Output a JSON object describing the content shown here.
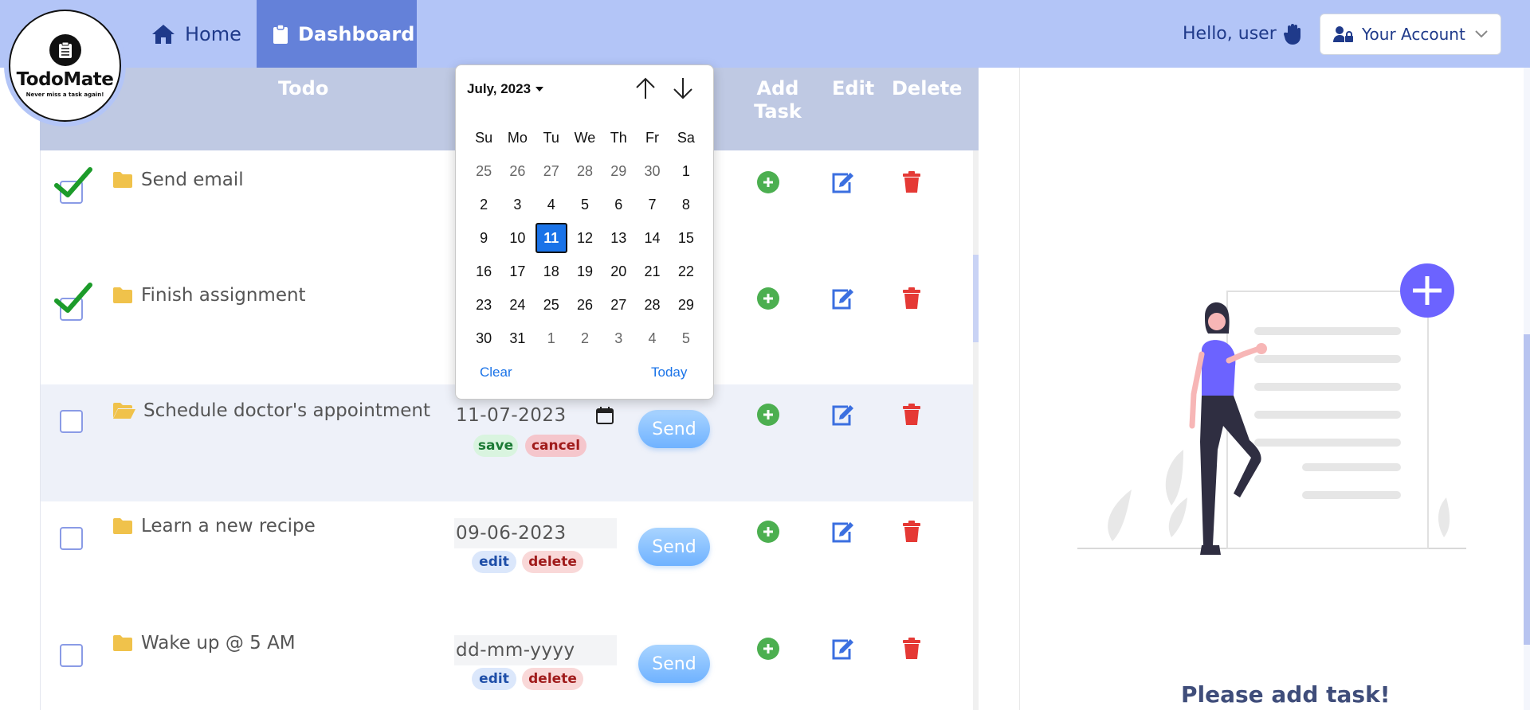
{
  "brand": {
    "name": "TodoMate",
    "tagline": "Never miss a task again!"
  },
  "nav": {
    "home_label": "Home",
    "dashboard_label": "Dashboard",
    "greeting": "Hello, user",
    "account_label": "Your Account"
  },
  "table": {
    "headers": {
      "todo": "Todo",
      "add_task": "Add Task",
      "edit": "Edit",
      "delete": "Delete"
    },
    "rows": [
      {
        "text": "Send email",
        "checked": true,
        "date": "",
        "send": ""
      },
      {
        "text": "Finish assignment",
        "checked": true,
        "date": "",
        "send": ""
      },
      {
        "text": "Schedule doctor's appointment",
        "checked": false,
        "date": "11-07-2023",
        "send": "Send",
        "action1": "save",
        "action2": "cancel"
      },
      {
        "text": "Learn a new recipe",
        "checked": false,
        "date": "09-06-2023",
        "send": "Send",
        "action1": "edit",
        "action2": "delete"
      },
      {
        "text": "Wake up @ 5 AM",
        "checked": false,
        "date": "dd-mm-yyyy",
        "send": "Send",
        "action1": "edit",
        "action2": "delete"
      }
    ]
  },
  "datepicker": {
    "month_label": "July, 2023",
    "weekdays": [
      "Su",
      "Mo",
      "Tu",
      "We",
      "Th",
      "Fr",
      "Sa"
    ],
    "weeks": [
      [
        "25",
        "26",
        "27",
        "28",
        "29",
        "30",
        "1"
      ],
      [
        "2",
        "3",
        "4",
        "5",
        "6",
        "7",
        "8"
      ],
      [
        "9",
        "10",
        "11",
        "12",
        "13",
        "14",
        "15"
      ],
      [
        "16",
        "17",
        "18",
        "19",
        "20",
        "21",
        "22"
      ],
      [
        "23",
        "24",
        "25",
        "26",
        "27",
        "28",
        "29"
      ],
      [
        "30",
        "31",
        "1",
        "2",
        "3",
        "4",
        "5"
      ]
    ],
    "selected": "11",
    "clear_label": "Clear",
    "today_label": "Today"
  },
  "empty_state": {
    "label": "Please add task!"
  },
  "colors": {
    "nav_bg": "#b3c5f7",
    "nav_active": "#6481d9",
    "accent_blue": "#1a73e8",
    "add_green": "#4caf50",
    "delete_red": "#e53935",
    "illustration_purple": "#6c63ff"
  }
}
